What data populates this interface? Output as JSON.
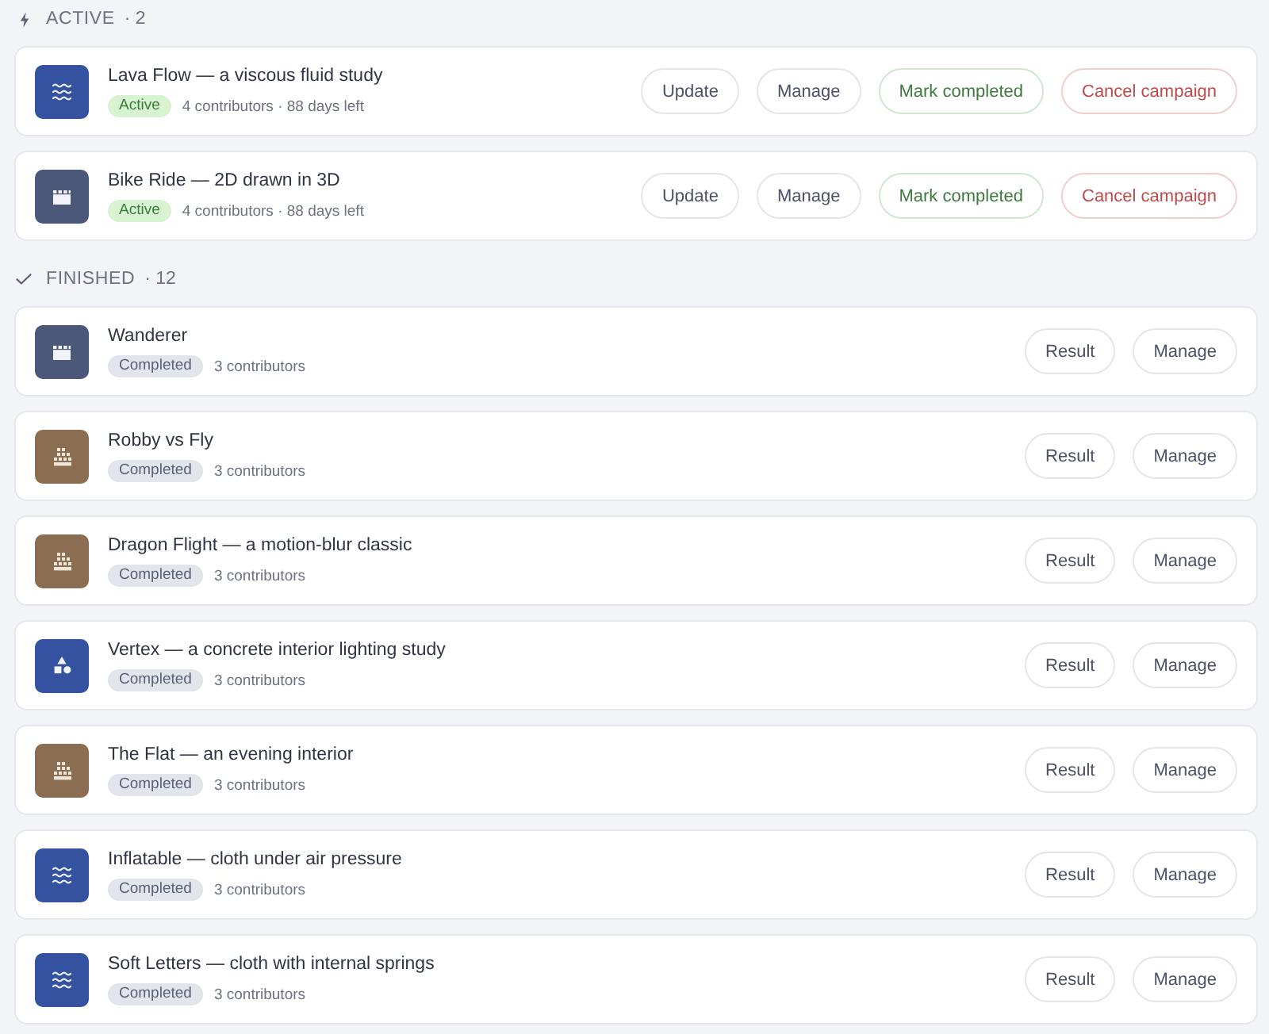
{
  "sections": [
    {
      "kind": "active",
      "title": "ACTIVE",
      "count": "· 2",
      "items": [
        {
          "title": "Lava Flow — a viscous fluid study",
          "icon": {
            "kind": "waves",
            "color": "#34529f"
          },
          "badge": {
            "kind": "active",
            "label": "Active"
          },
          "meta": "4 contributors · 88 days left",
          "buttons": [
            {
              "kind": "plain",
              "label": "Update"
            },
            {
              "kind": "plain",
              "label": "Manage"
            },
            {
              "kind": "success",
              "label": "Mark completed"
            },
            {
              "kind": "danger",
              "label": "Cancel campaign"
            }
          ]
        },
        {
          "title": "Bike Ride — 2D drawn in 3D",
          "icon": {
            "kind": "film",
            "color": "#4c5877"
          },
          "badge": {
            "kind": "active",
            "label": "Active"
          },
          "meta": "4 contributors · 88 days left",
          "buttons": [
            {
              "kind": "plain",
              "label": "Update"
            },
            {
              "kind": "plain",
              "label": "Manage"
            },
            {
              "kind": "success",
              "label": "Mark completed"
            },
            {
              "kind": "danger",
              "label": "Cancel campaign"
            }
          ]
        }
      ]
    },
    {
      "kind": "finished",
      "title": "FINISHED",
      "count": "· 12",
      "items": [
        {
          "title": "Wanderer",
          "icon": {
            "kind": "film",
            "color": "#4c5877"
          },
          "badge": {
            "kind": "completed",
            "label": "Completed"
          },
          "meta": "3 contributors",
          "buttons": [
            {
              "kind": "plain",
              "label": "Result"
            },
            {
              "kind": "plain",
              "label": "Manage"
            }
          ]
        },
        {
          "title": "Robby vs Fly",
          "icon": {
            "kind": "building",
            "color": "#8b6e52"
          },
          "badge": {
            "kind": "completed",
            "label": "Completed"
          },
          "meta": "3 contributors",
          "buttons": [
            {
              "kind": "plain",
              "label": "Result"
            },
            {
              "kind": "plain",
              "label": "Manage"
            }
          ]
        },
        {
          "title": "Dragon Flight — a motion-blur classic",
          "icon": {
            "kind": "building",
            "color": "#8b6e52"
          },
          "badge": {
            "kind": "completed",
            "label": "Completed"
          },
          "meta": "3 contributors",
          "buttons": [
            {
              "kind": "plain",
              "label": "Result"
            },
            {
              "kind": "plain",
              "label": "Manage"
            }
          ]
        },
        {
          "title": "Vertex — a concrete interior lighting study",
          "icon": {
            "kind": "shapes",
            "color": "#34529f"
          },
          "badge": {
            "kind": "completed",
            "label": "Completed"
          },
          "meta": "3 contributors",
          "buttons": [
            {
              "kind": "plain",
              "label": "Result"
            },
            {
              "kind": "plain",
              "label": "Manage"
            }
          ]
        },
        {
          "title": "The Flat — an evening interior",
          "icon": {
            "kind": "building",
            "color": "#8b6e52"
          },
          "badge": {
            "kind": "completed",
            "label": "Completed"
          },
          "meta": "3 contributors",
          "buttons": [
            {
              "kind": "plain",
              "label": "Result"
            },
            {
              "kind": "plain",
              "label": "Manage"
            }
          ]
        },
        {
          "title": "Inflatable — cloth under air pressure",
          "icon": {
            "kind": "waves",
            "color": "#34529f"
          },
          "badge": {
            "kind": "completed",
            "label": "Completed"
          },
          "meta": "3 contributors",
          "buttons": [
            {
              "kind": "plain",
              "label": "Result"
            },
            {
              "kind": "plain",
              "label": "Manage"
            }
          ]
        },
        {
          "title": "Soft Letters — cloth with internal springs",
          "icon": {
            "kind": "waves",
            "color": "#34529f"
          },
          "badge": {
            "kind": "completed",
            "label": "Completed"
          },
          "meta": "3 contributors",
          "buttons": [
            {
              "kind": "plain",
              "label": "Result"
            },
            {
              "kind": "plain",
              "label": "Manage"
            }
          ]
        }
      ]
    }
  ]
}
